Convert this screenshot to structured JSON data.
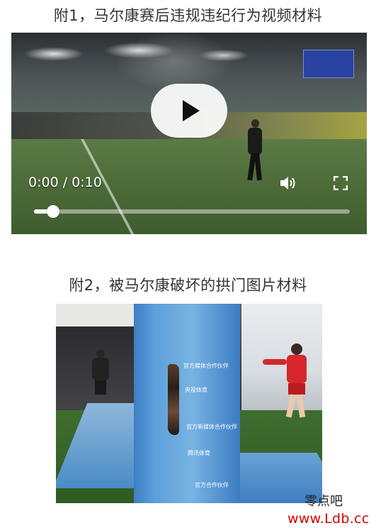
{
  "captions": {
    "video_caption": "附1，马尔康赛后违规违纪行为视频材料",
    "photo_caption": "附2，被马尔康破坏的拱门图片材料"
  },
  "video_player": {
    "time_display": "0:00 / 0:10",
    "progress_fraction": 0.06,
    "icons": {
      "play": "play-icon",
      "volume": "volume-icon",
      "fullscreen": "fullscreen-icon"
    }
  },
  "photo": {
    "arch_signs": [
      "官方媒体合作伙伴",
      "央视体育",
      "官方新媒体合作伙伴",
      "腾讯体育",
      "官方合作伙伴"
    ]
  },
  "watermark": {
    "name": "零点吧",
    "url": "www.Ldb.cc"
  },
  "colors": {
    "watermark_url": "#d40000",
    "arch_blue": "#5da0da"
  }
}
